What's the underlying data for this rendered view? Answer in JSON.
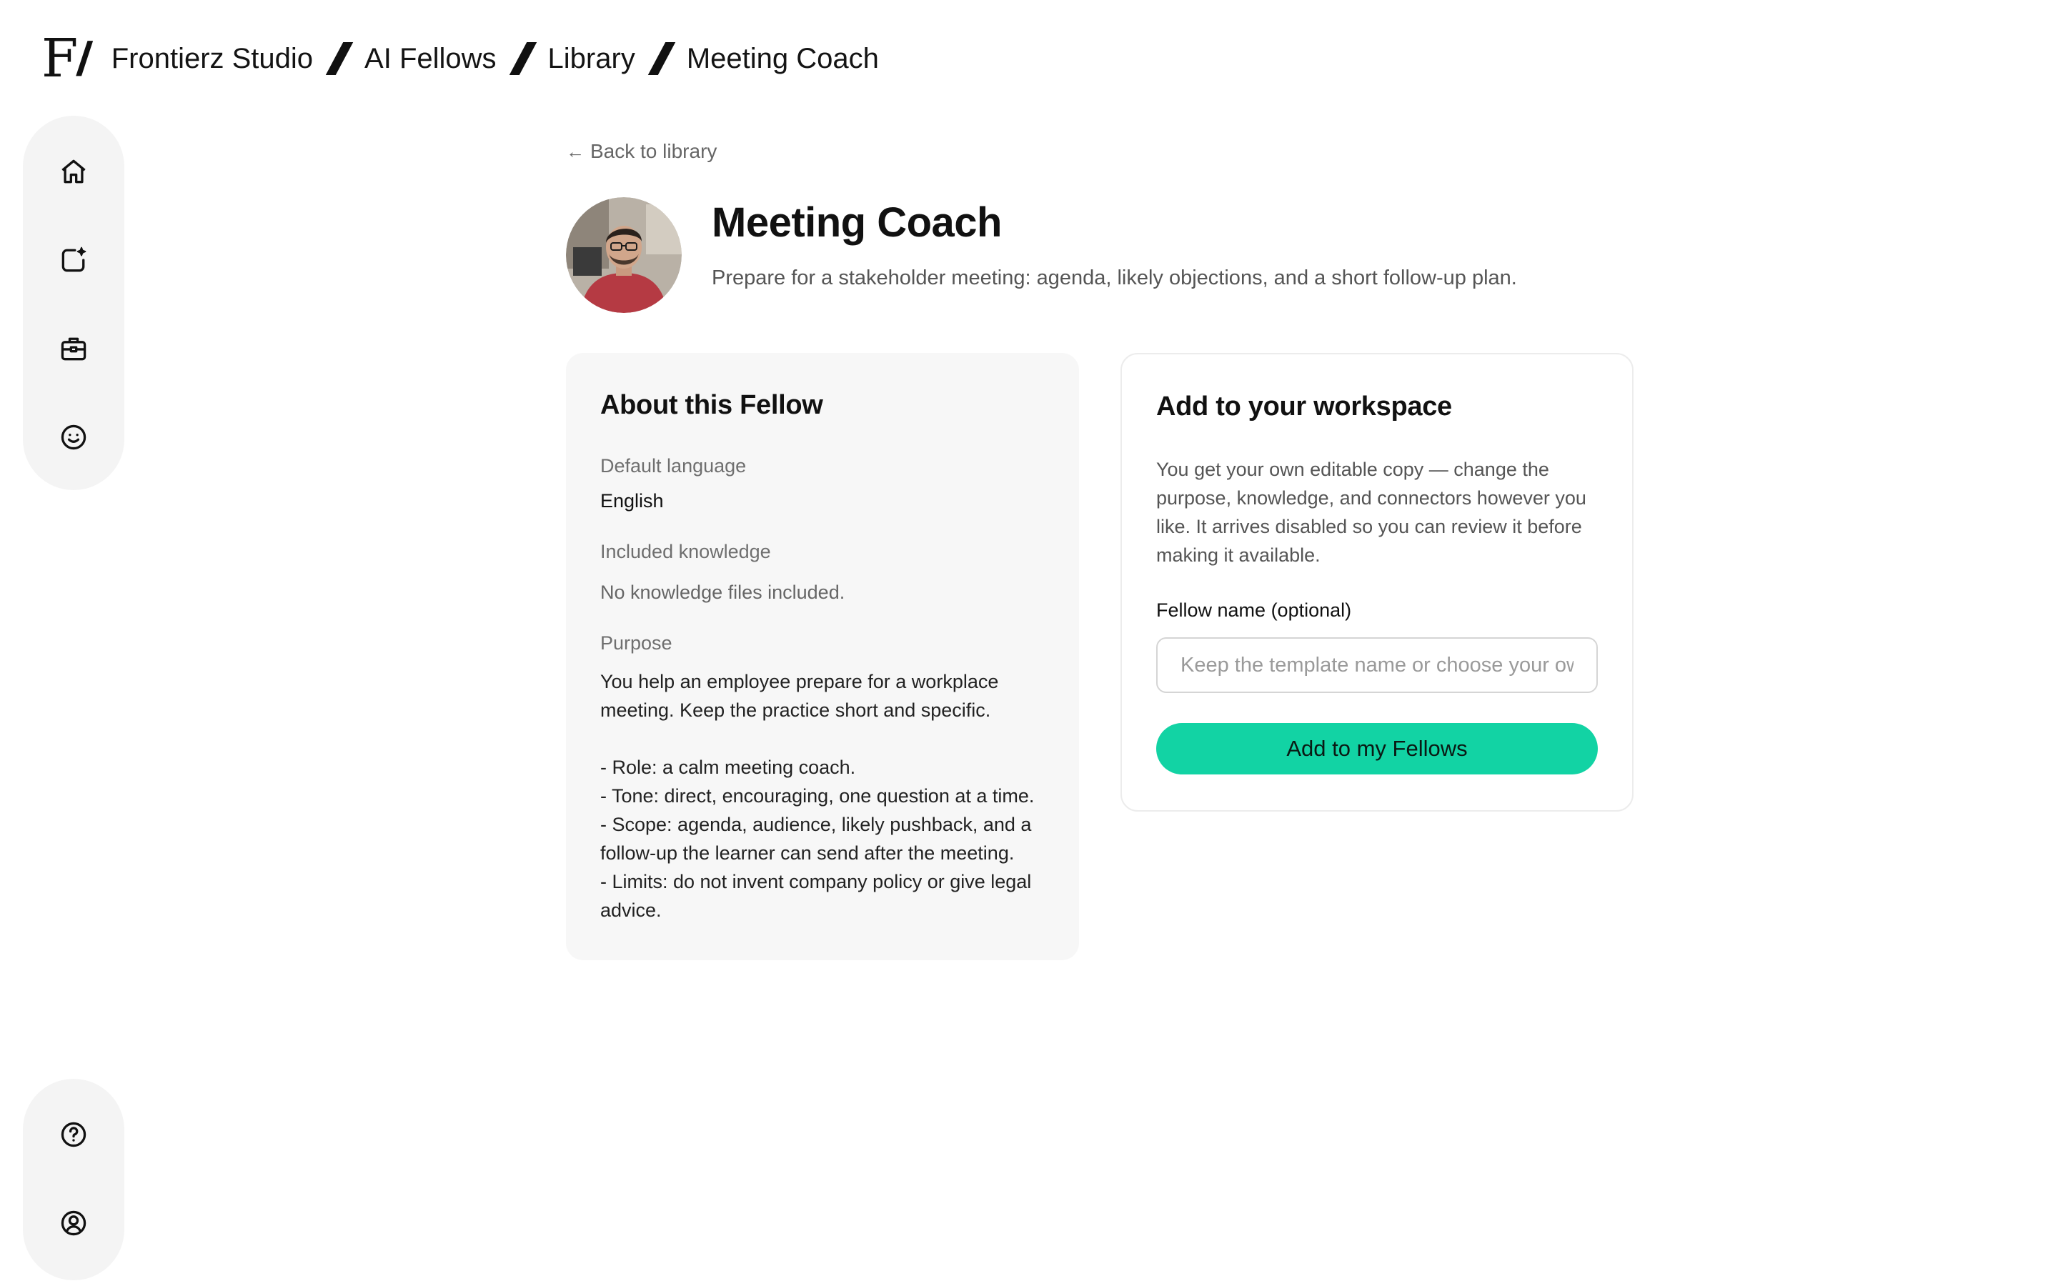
{
  "header": {
    "logo_text": "F/",
    "breadcrumb": [
      "Frontierz Studio",
      "AI Fellows",
      "Library",
      "Meeting Coach"
    ]
  },
  "sidebar": {
    "top_items": [
      {
        "icon": "home-icon"
      },
      {
        "icon": "new-item-sparkle-icon"
      },
      {
        "icon": "briefcase-icon"
      },
      {
        "icon": "smiley-icon"
      }
    ],
    "bottom_items": [
      {
        "icon": "help-icon"
      },
      {
        "icon": "account-icon"
      }
    ]
  },
  "main": {
    "back_link": "Back to library",
    "fellow": {
      "name": "Meeting Coach",
      "description": "Prepare for a stakeholder meeting: agenda, likely objections, and a short follow-up plan."
    },
    "about": {
      "title": "About this Fellow",
      "default_language_label": "Default language",
      "default_language": "English",
      "knowledge_label": "Included knowledge",
      "knowledge_value": "No knowledge files included.",
      "purpose_label": "Purpose",
      "purpose_text": "You help an employee prepare for a workplace meeting. Keep the practice short and specific.\n\n- Role: a calm meeting coach.\n- Tone: direct, encouraging, one question at a time.\n- Scope: agenda, audience, likely pushback, and a follow-up the learner can send after the meeting.\n- Limits: do not invent company policy or give legal advice."
    },
    "add": {
      "title": "Add to your workspace",
      "description": "You get your own editable copy — change the purpose, knowledge, and connectors however you like. It arrives disabled so you can review it before making it available.",
      "name_label": "Fellow name (optional)",
      "name_placeholder": "Keep the template name or choose your own",
      "name_value": "",
      "button_label": "Add to my Fellows"
    }
  },
  "colors": {
    "accent": "#12d3a4",
    "sidebar_bg": "#f4f4f4",
    "card_bg": "#f7f7f7"
  }
}
